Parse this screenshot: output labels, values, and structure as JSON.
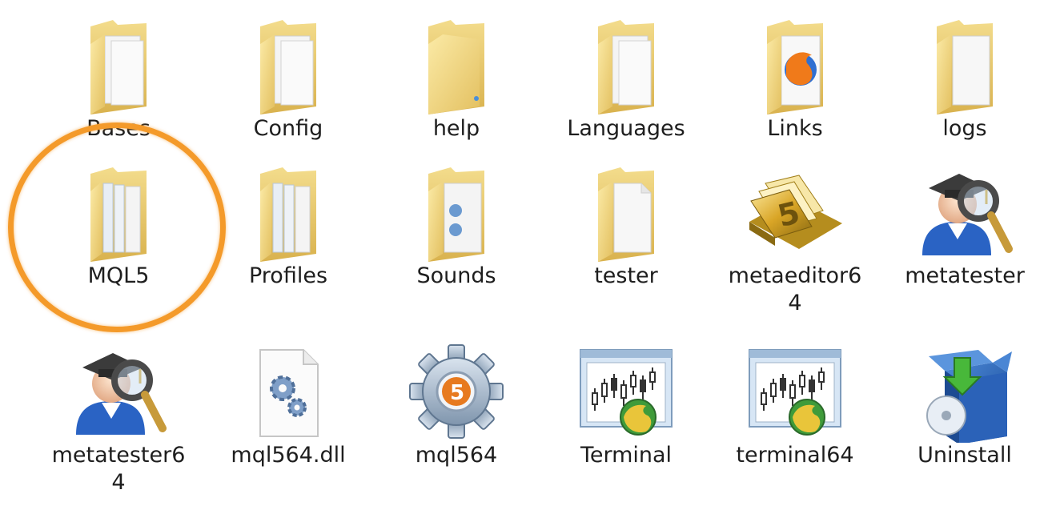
{
  "items": [
    {
      "label": "Bases",
      "icon": "folder-icon"
    },
    {
      "label": "Config",
      "icon": "folder-icon"
    },
    {
      "label": "help",
      "icon": "folder-icon"
    },
    {
      "label": "Languages",
      "icon": "folder-icon"
    },
    {
      "label": "Links",
      "icon": "firefox-folder-icon"
    },
    {
      "label": "logs",
      "icon": "folder-icon"
    },
    {
      "label": "MQL5",
      "icon": "folder-icon"
    },
    {
      "label": "Profiles",
      "icon": "folder-icon"
    },
    {
      "label": "Sounds",
      "icon": "folder-icon"
    },
    {
      "label": "tester",
      "icon": "folder-icon"
    },
    {
      "label": "metaeditor64",
      "icon": "metaeditor-icon"
    },
    {
      "label": "metatester",
      "icon": "metatester-icon"
    },
    {
      "label": "metatester64",
      "icon": "metatester-icon"
    },
    {
      "label": "mql564.dll",
      "icon": "dll-file-icon"
    },
    {
      "label": "mql564",
      "icon": "gear-5-icon"
    },
    {
      "label": "Terminal",
      "icon": "terminal-icon"
    },
    {
      "label": "terminal64",
      "icon": "terminal-icon"
    },
    {
      "label": "Uninstall",
      "icon": "uninstall-icon"
    }
  ],
  "highlight": {
    "target": "MQL5",
    "color": "#f49a2a"
  }
}
